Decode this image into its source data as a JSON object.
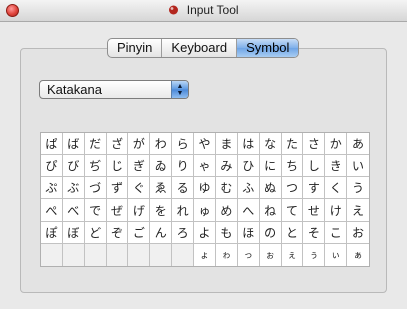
{
  "window": {
    "title": "Input Tool",
    "close_icon": "close-button-red",
    "title_icon": "input-tool-icon"
  },
  "tabs": [
    {
      "label": "Pinyin",
      "selected": false
    },
    {
      "label": "Keyboard",
      "selected": false
    },
    {
      "label": "Symbol",
      "selected": true
    }
  ],
  "dropdown": {
    "selected": "Katakana",
    "arrow_icon": "up-down-arrows-icon"
  },
  "grid": {
    "rows": [
      [
        "ぱ",
        "ば",
        "だ",
        "ざ",
        "が",
        "わ",
        "ら",
        "や",
        "ま",
        "は",
        "な",
        "た",
        "さ",
        "か",
        "あ"
      ],
      [
        "ぴ",
        "び",
        "ぢ",
        "じ",
        "ぎ",
        "ゐ",
        "り",
        "ゃ",
        "み",
        "ひ",
        "に",
        "ち",
        "し",
        "き",
        "い"
      ],
      [
        "ぷ",
        "ぶ",
        "づ",
        "ず",
        "ぐ",
        "ゑ",
        "る",
        "ゆ",
        "む",
        "ふ",
        "ぬ",
        "つ",
        "す",
        "く",
        "う"
      ],
      [
        "ぺ",
        "べ",
        "で",
        "ぜ",
        "げ",
        "を",
        "れ",
        "ゅ",
        "め",
        "へ",
        "ね",
        "て",
        "せ",
        "け",
        "え"
      ],
      [
        "ぽ",
        "ぼ",
        "ど",
        "ぞ",
        "ご",
        "ん",
        "ろ",
        "よ",
        "も",
        "ほ",
        "の",
        "と",
        "そ",
        "こ",
        "お"
      ],
      [
        "",
        "",
        "",
        "",
        "",
        "",
        "",
        "ょ",
        "ゎ",
        "っ",
        "ぉ",
        "ぇ",
        "ぅ",
        "ぃ",
        "ぁ"
      ]
    ]
  },
  "colors": {
    "accent": "#6ea4e6",
    "close": "#e0443c"
  }
}
